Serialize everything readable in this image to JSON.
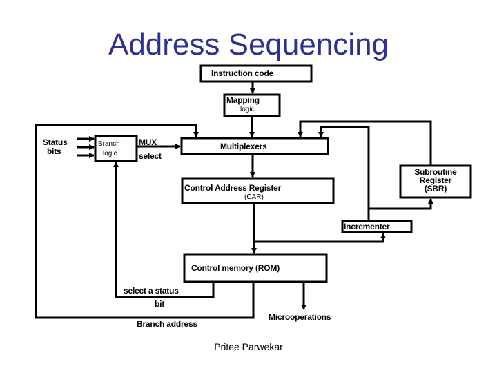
{
  "title": "Address Sequencing",
  "colors": {
    "title": "#2e3192",
    "lines": "#000000"
  },
  "blocks": {
    "instruction_code": "Instruction code",
    "mapping": {
      "line1": "Mapping",
      "line2": "logic"
    },
    "status_bits": {
      "line1": "Status",
      "line2": "bits"
    },
    "branch_logic": {
      "line1": "Branch",
      "line2": "logic"
    },
    "multiplexers": "Multiplexers",
    "car": {
      "line1": "Control Address Register",
      "line2": "(CAR)"
    },
    "sbr": {
      "line1": "Subroutine",
      "line2": "Register",
      "line3": "(SBR)"
    },
    "incrementer": "Incrementer",
    "control_memory": "Control memory (ROM)"
  },
  "signals": {
    "mux_select": {
      "line1": "MUX",
      "line2": "select"
    },
    "select_status": {
      "line1": "select a status",
      "line2": "bit"
    },
    "branch_address": "Branch address",
    "microoperations": "Microoperations"
  },
  "footer": "Pritee Parwekar"
}
